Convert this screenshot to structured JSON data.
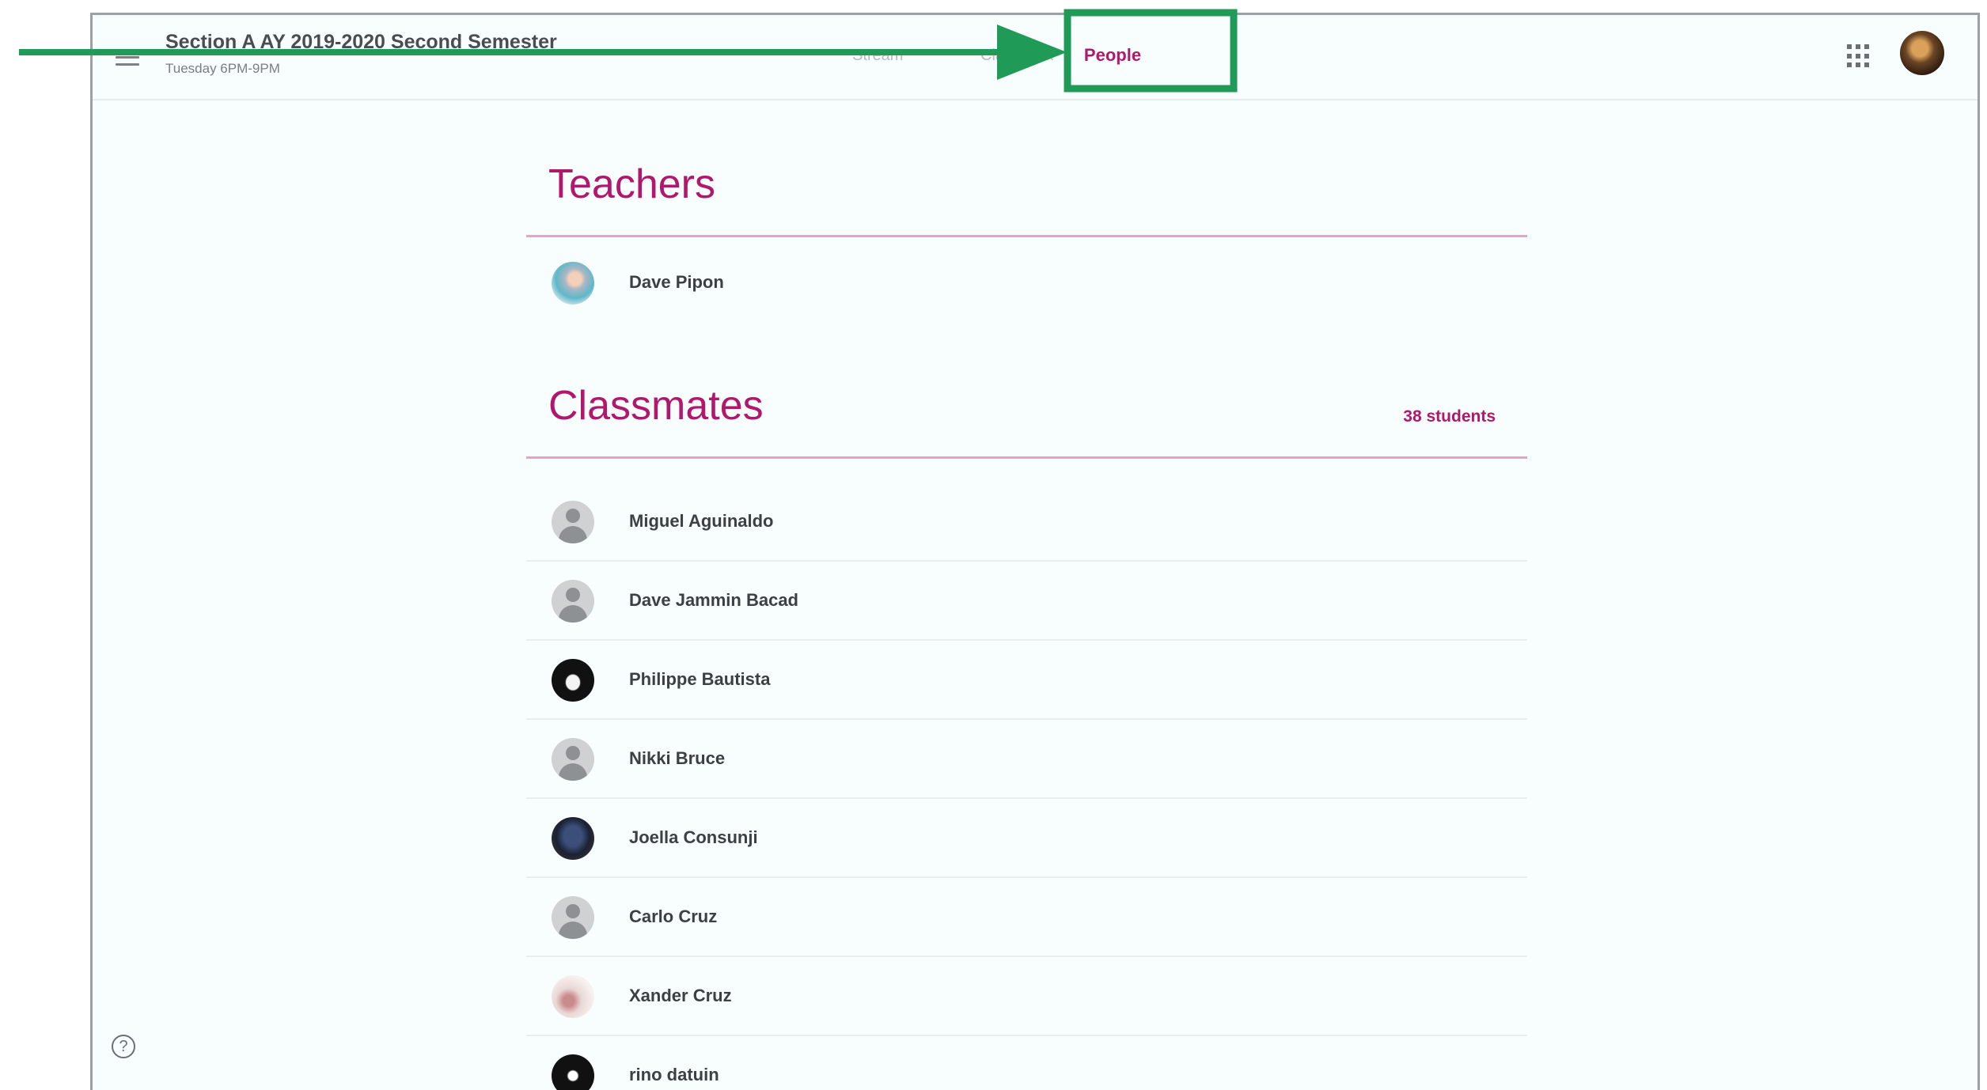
{
  "header": {
    "class_title": "Section A AY 2019-2020 Second Semester",
    "class_subtitle": "Tuesday 6PM-9PM",
    "tabs": [
      {
        "label": "Stream"
      },
      {
        "label": "Classwork"
      },
      {
        "label": "People",
        "active": true
      }
    ],
    "apps_icon": "apps-grid-icon",
    "account_icon": "account-avatar"
  },
  "teachers": {
    "title": "Teachers",
    "people": [
      {
        "name": "Dave Pipon",
        "avatar": "photo"
      }
    ]
  },
  "classmates": {
    "title": "Classmates",
    "count": "38 students",
    "people": [
      {
        "name": "Miguel Aguinaldo",
        "avatar": "generic"
      },
      {
        "name": "Dave Jammin Bacad",
        "avatar": "generic"
      },
      {
        "name": "Philippe Bautista",
        "avatar": "photo"
      },
      {
        "name": "Nikki Bruce",
        "avatar": "generic"
      },
      {
        "name": "Joella Consunji",
        "avatar": "photo"
      },
      {
        "name": "Carlo Cruz",
        "avatar": "generic"
      },
      {
        "name": "Xander Cruz",
        "avatar": "photo"
      },
      {
        "name": "rino datuin",
        "avatar": "photo"
      }
    ]
  },
  "help": {
    "icon": "help-icon",
    "glyph": "?"
  },
  "colors": {
    "accent": "#b0186e",
    "annotation": "#1f9a57"
  }
}
